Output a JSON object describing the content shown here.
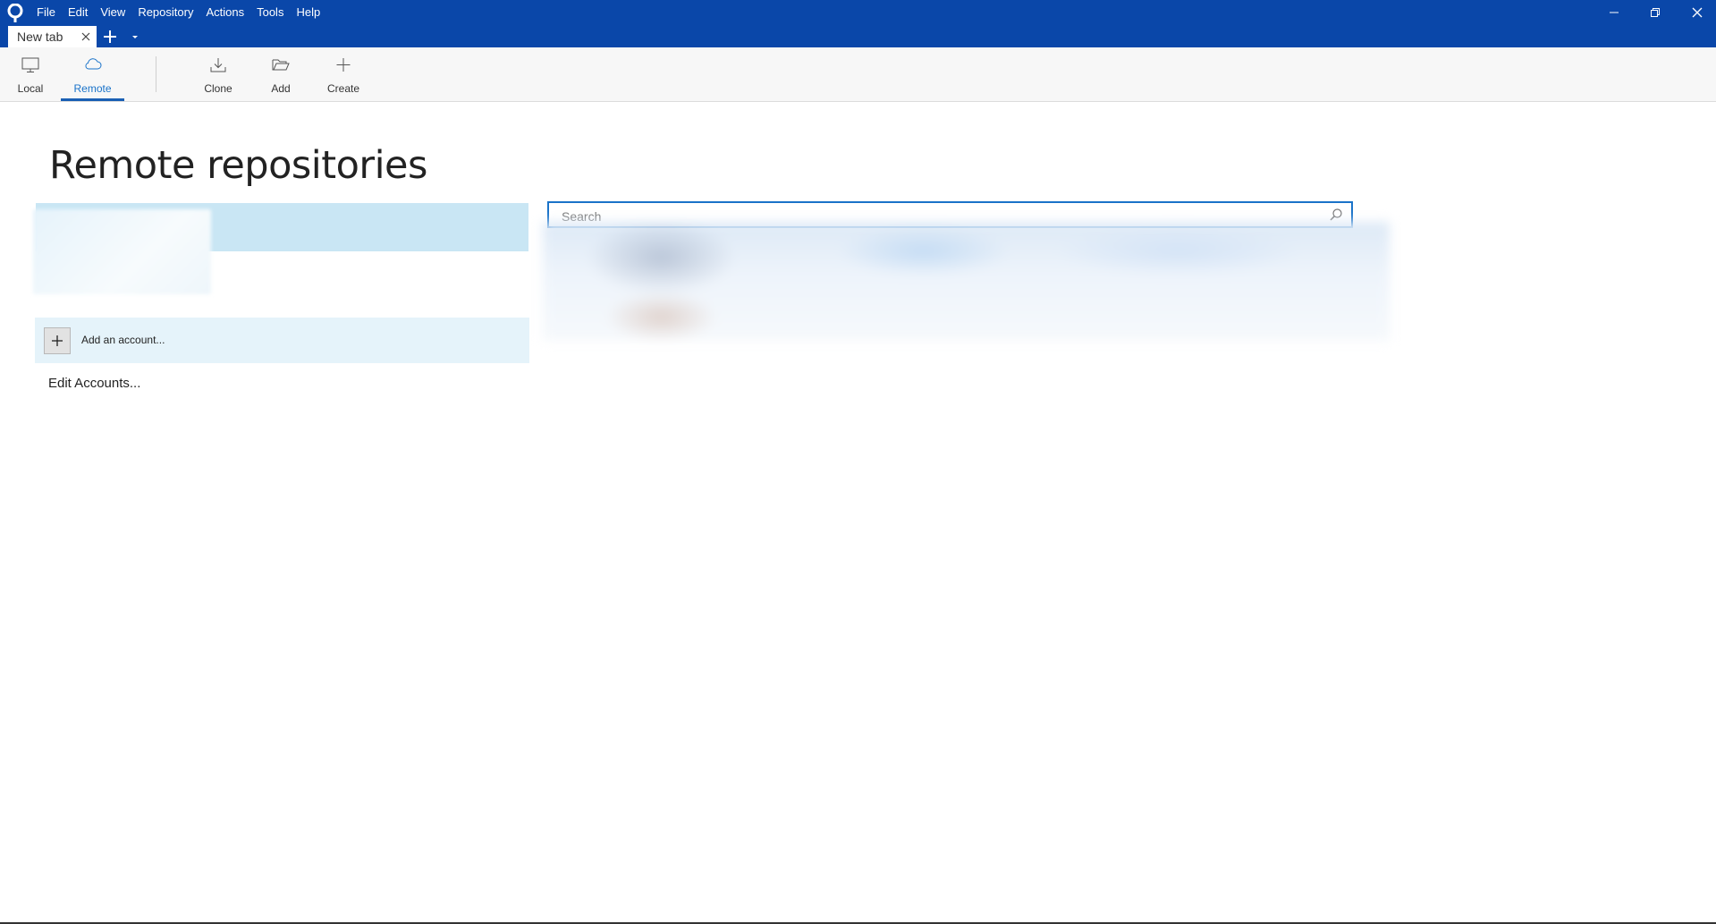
{
  "menu": {
    "items": [
      {
        "label": "File"
      },
      {
        "label": "Edit"
      },
      {
        "label": "View"
      },
      {
        "label": "Repository"
      },
      {
        "label": "Actions"
      },
      {
        "label": "Tools"
      },
      {
        "label": "Help"
      }
    ]
  },
  "tabs": [
    {
      "label": "New tab",
      "active": true
    }
  ],
  "toolbar": {
    "local_label": "Local",
    "remote_label": "Remote",
    "clone_label": "Clone",
    "add_label": "Add",
    "create_label": "Create",
    "active": "Remote"
  },
  "main": {
    "title": "Remote repositories",
    "add_account_label": "Add an account...",
    "edit_accounts_label": "Edit Accounts...",
    "search": {
      "value": "",
      "placeholder": "Search"
    }
  },
  "colors": {
    "titlebar": "#0a47a9",
    "accent": "#1a73c9",
    "selected_row": "#c9e6f4",
    "hover_row": "#e5f3fa"
  },
  "icons": [
    "sourcetree-logo-icon",
    "minimize-icon",
    "restore-icon",
    "close-icon",
    "tab-close-icon",
    "plus-icon",
    "chevron-down-icon",
    "monitor-icon",
    "cloud-icon",
    "download-icon",
    "folder-open-icon",
    "search-icon"
  ]
}
